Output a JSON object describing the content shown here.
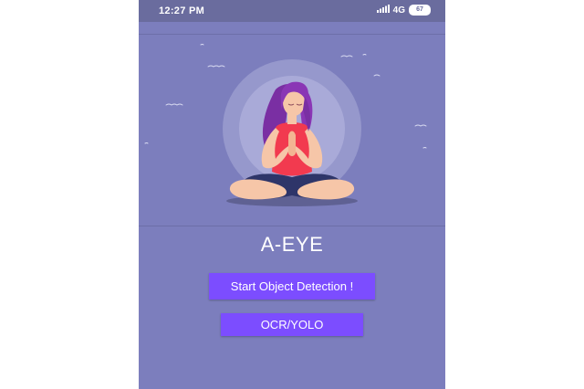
{
  "status_bar": {
    "time": "12:27 PM",
    "network": "4G",
    "battery": "67",
    "signal_icon": "signal-bars-icon"
  },
  "hero": {
    "illustration": "meditating-woman-illustration",
    "colors": {
      "background": "#7c7ebd",
      "halo": "#a9aad8",
      "hair": "#7a2fa3",
      "top": "#f23a4f",
      "skin": "#f6c6a8",
      "pants": "#2e3569"
    }
  },
  "app": {
    "title": "A-EYE"
  },
  "buttons": {
    "start_detection": "Start Object Detection !",
    "ocr_yolo": "OCR/YOLO"
  },
  "colors": {
    "accent": "#7c4dff",
    "screen_background": "#7c7ebd",
    "status_bar": "#6a6c9e"
  }
}
